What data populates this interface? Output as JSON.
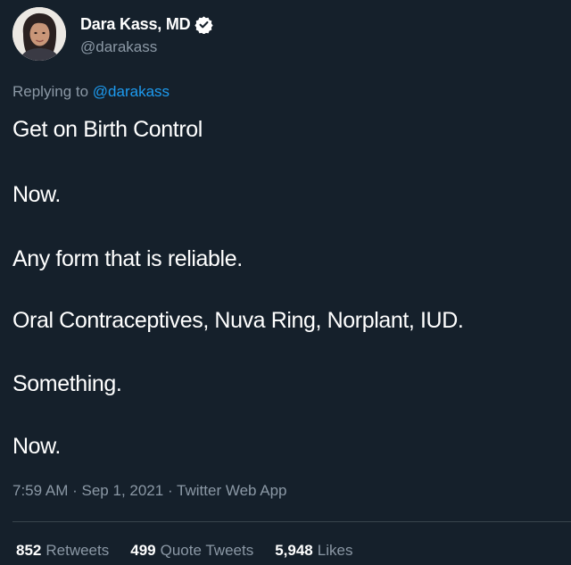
{
  "author": {
    "display_name": "Dara Kass, MD",
    "handle": "@darakass",
    "verified_icon": "verified-badge-icon",
    "avatar_icon": "profile-avatar"
  },
  "reply": {
    "prefix": "Replying to",
    "mention": "@darakass"
  },
  "tweet_lines": [
    "Get on Birth Control",
    "Now.",
    "Any form that is reliable.",
    "Oral Contraceptives, Nuva Ring, Norplant, IUD.",
    "Something.",
    "Now."
  ],
  "meta": {
    "time": "7:59 AM",
    "date": "Sep 1, 2021",
    "source": "Twitter Web App",
    "separator": "·"
  },
  "stats": {
    "retweets_count": "852",
    "retweets_label": "Retweets",
    "quotes_count": "499",
    "quotes_label": "Quote Tweets",
    "likes_count": "5,948",
    "likes_label": "Likes"
  },
  "colors": {
    "background": "#15202b",
    "text_primary": "#ffffff",
    "text_secondary": "#8b98a5",
    "link": "#1d9bf0",
    "divider": "#38444d"
  }
}
